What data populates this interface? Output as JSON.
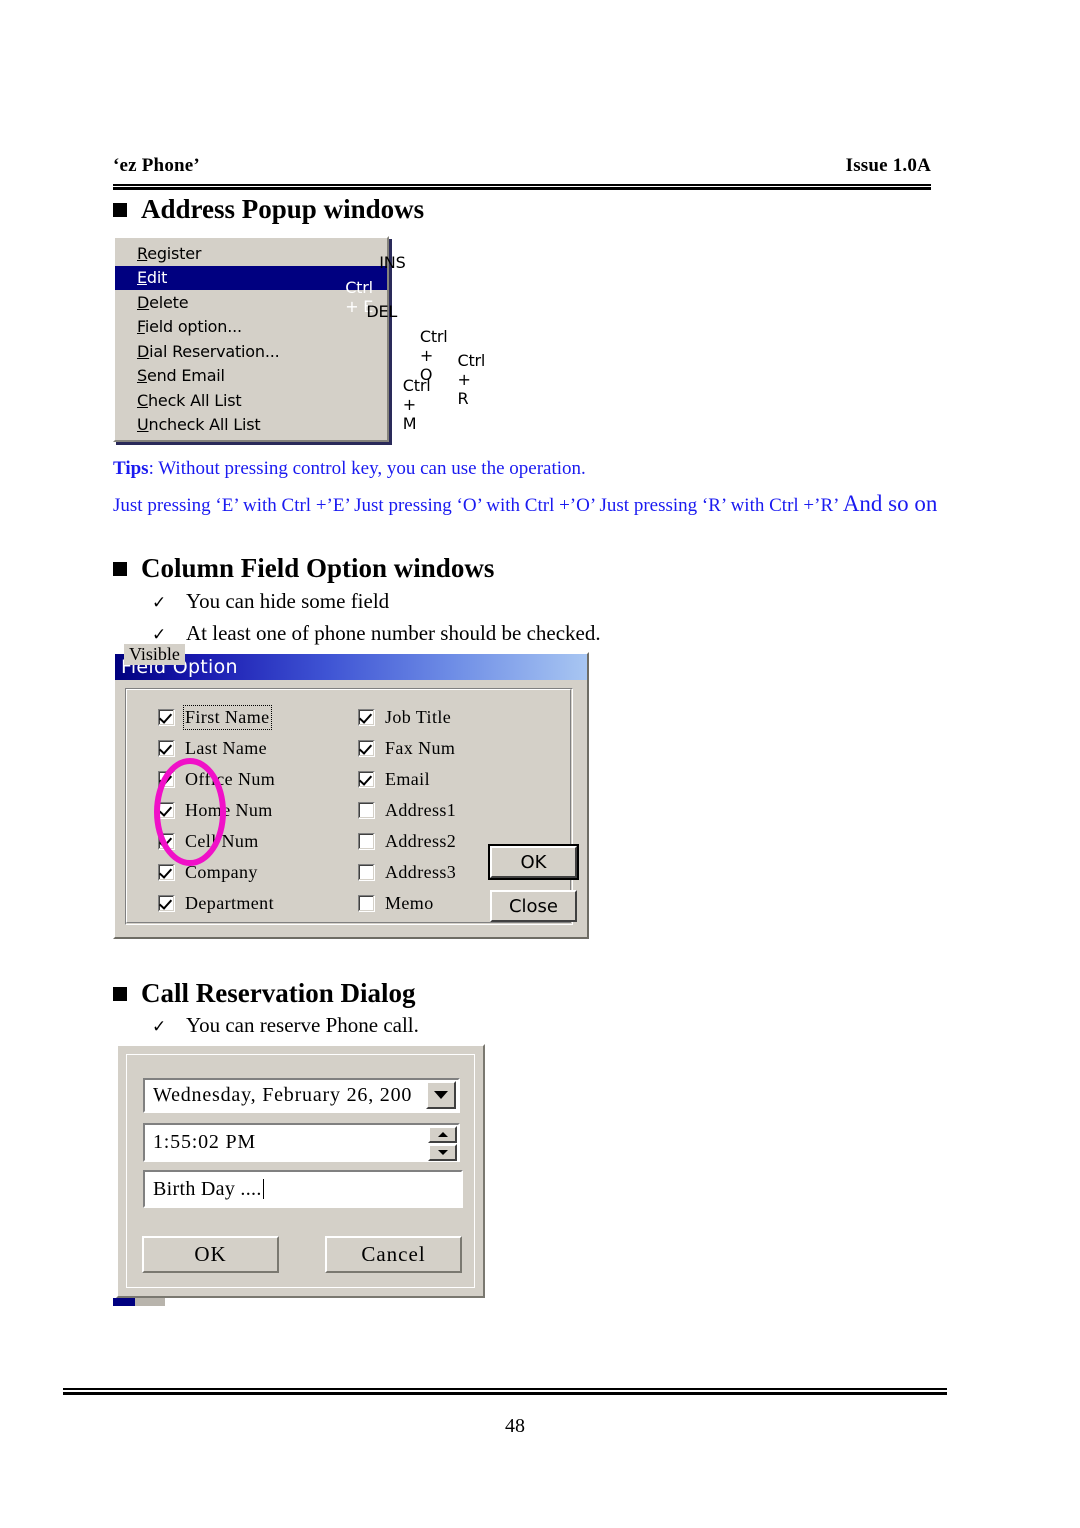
{
  "document": {
    "header": {
      "left_text": "‘ez Phone’",
      "right_text": "Issue 1.0A"
    },
    "footer": {
      "page_number": "48"
    }
  },
  "sections": [
    {
      "title": "Address Popup windows"
    },
    {
      "title": "Column Field Option windows"
    },
    {
      "title": "Call Reservation Dialog"
    }
  ],
  "bullets": {
    "check_glyph": "✓",
    "column_field": [
      "You can hide some field",
      "At least one of phone number should be checked."
    ],
    "call_reservation": [
      "You can reserve Phone call."
    ]
  },
  "tips": {
    "label": "Tips",
    "line1_rest": ": Without pressing control key, you can use the operation.",
    "line2_main": "Just pressing ‘E’ with Ctrl +’E’ Just pressing ‘O’ with Ctrl +’O’ Just pressing ‘R’ with Ctrl +’R’ ",
    "line2_tail": "And so on",
    "color": "#1a1af0"
  },
  "context_menu": {
    "items": [
      {
        "label": "Register",
        "mnemonic": "R",
        "accel": "INS",
        "selected": false
      },
      {
        "label": "Edit",
        "mnemonic": "E",
        "accel": "Ctrl + E",
        "selected": true
      },
      {
        "label": "Delete",
        "mnemonic": "D",
        "accel": "DEL",
        "selected": false
      },
      {
        "label": "Field option...",
        "mnemonic": "F",
        "accel": "Ctrl + O",
        "selected": false
      },
      {
        "label": "Dial Reservation...",
        "mnemonic": "D",
        "accel": "Ctrl + R",
        "selected": false
      },
      {
        "label": "Send Email",
        "mnemonic": "S",
        "accel": "Ctrl + M",
        "selected": false
      },
      {
        "label": "Check All List",
        "mnemonic": "C",
        "accel": "",
        "selected": false
      },
      {
        "label": "Uncheck All List",
        "mnemonic": "U",
        "accel": "",
        "selected": false
      }
    ],
    "highlight_color": "#000080"
  },
  "field_option_dialog": {
    "title": "Field Option",
    "group_title": "Visible",
    "left_column": [
      {
        "label": "First Name",
        "checked": true,
        "focused": true
      },
      {
        "label": "Last Name",
        "checked": true,
        "focused": false
      },
      {
        "label": "Office Num",
        "checked": true,
        "focused": false
      },
      {
        "label": "Home Num",
        "checked": true,
        "focused": false
      },
      {
        "label": "Cell Num",
        "checked": true,
        "focused": false
      },
      {
        "label": "Company",
        "checked": true,
        "focused": false
      },
      {
        "label": "Department",
        "checked": true,
        "focused": false
      }
    ],
    "right_column": [
      {
        "label": "Job Title",
        "checked": true,
        "focused": false
      },
      {
        "label": "Fax Num",
        "checked": true,
        "focused": false
      },
      {
        "label": "Email",
        "checked": true,
        "focused": false
      },
      {
        "label": "Address1",
        "checked": false,
        "focused": false
      },
      {
        "label": "Address2",
        "checked": false,
        "focused": false
      },
      {
        "label": "Address3",
        "checked": false,
        "focused": false
      },
      {
        "label": "Memo",
        "checked": false,
        "focused": false
      }
    ],
    "ok_label": "OK",
    "close_label": "Close",
    "annotation_color": "#f010c8"
  },
  "call_reservation_dialog": {
    "date_value": "Wednesday,  February  26, 200",
    "time_value": "1:55:02 PM",
    "memo_value": "Birth Day ....",
    "ok_label": "OK",
    "cancel_label": "Cancel",
    "dropdown_icon": "chevron-down-icon",
    "spin_up_icon": "chevron-up-icon",
    "spin_down_icon": "chevron-down-icon"
  }
}
